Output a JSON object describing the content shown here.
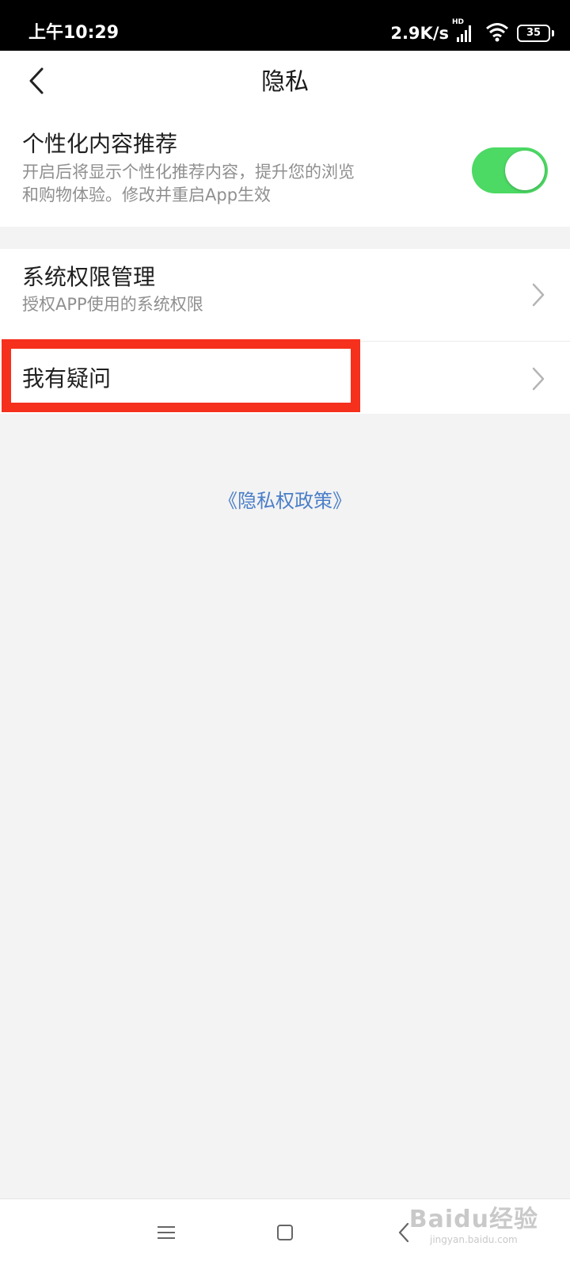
{
  "status_bar": {
    "time": "上午10:29",
    "net_speed": "2.9K/s",
    "signal_label": "HD",
    "battery": "35"
  },
  "header": {
    "title": "隐私",
    "back_icon": "chevron-left-icon"
  },
  "personalization": {
    "title": "个性化内容推荐",
    "description_line1": "开启后将显示个性化推荐内容，提升您的浏览",
    "description_line2": "和购物体验。修改并重启App生效",
    "toggle_on": true,
    "toggle_color": "#4cd964"
  },
  "list": {
    "items": [
      {
        "title": "系统权限管理",
        "subtitle": "授权APP使用的系统权限"
      },
      {
        "title": "我有疑问"
      }
    ]
  },
  "highlight_color": "#f5301c",
  "policy_link": "《隐私权政策》",
  "link_color": "#4a7ec8",
  "nav_bar": {
    "icons": [
      "menu-icon",
      "home-icon",
      "back-icon"
    ]
  },
  "watermark": {
    "logo": "Baidu经验",
    "url": "jingyan.baidu.com"
  }
}
